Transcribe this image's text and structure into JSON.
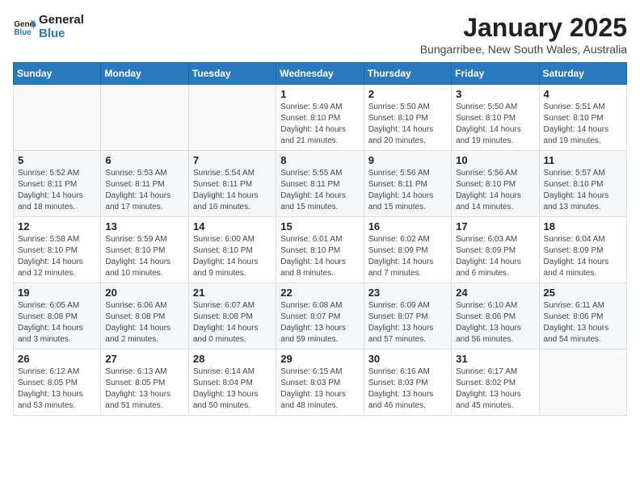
{
  "logo": {
    "text_general": "General",
    "text_blue": "Blue"
  },
  "header": {
    "title": "January 2025",
    "subtitle": "Bungarribee, New South Wales, Australia"
  },
  "weekdays": [
    "Sunday",
    "Monday",
    "Tuesday",
    "Wednesday",
    "Thursday",
    "Friday",
    "Saturday"
  ],
  "weeks": [
    [
      {
        "day": "",
        "info": ""
      },
      {
        "day": "",
        "info": ""
      },
      {
        "day": "",
        "info": ""
      },
      {
        "day": "1",
        "info": "Sunrise: 5:49 AM\nSunset: 8:10 PM\nDaylight: 14 hours\nand 21 minutes."
      },
      {
        "day": "2",
        "info": "Sunrise: 5:50 AM\nSunset: 8:10 PM\nDaylight: 14 hours\nand 20 minutes."
      },
      {
        "day": "3",
        "info": "Sunrise: 5:50 AM\nSunset: 8:10 PM\nDaylight: 14 hours\nand 19 minutes."
      },
      {
        "day": "4",
        "info": "Sunrise: 5:51 AM\nSunset: 8:10 PM\nDaylight: 14 hours\nand 19 minutes."
      }
    ],
    [
      {
        "day": "5",
        "info": "Sunrise: 5:52 AM\nSunset: 8:11 PM\nDaylight: 14 hours\nand 18 minutes."
      },
      {
        "day": "6",
        "info": "Sunrise: 5:53 AM\nSunset: 8:11 PM\nDaylight: 14 hours\nand 17 minutes."
      },
      {
        "day": "7",
        "info": "Sunrise: 5:54 AM\nSunset: 8:11 PM\nDaylight: 14 hours\nand 16 minutes."
      },
      {
        "day": "8",
        "info": "Sunrise: 5:55 AM\nSunset: 8:11 PM\nDaylight: 14 hours\nand 15 minutes."
      },
      {
        "day": "9",
        "info": "Sunrise: 5:56 AM\nSunset: 8:11 PM\nDaylight: 14 hours\nand 15 minutes."
      },
      {
        "day": "10",
        "info": "Sunrise: 5:56 AM\nSunset: 8:10 PM\nDaylight: 14 hours\nand 14 minutes."
      },
      {
        "day": "11",
        "info": "Sunrise: 5:57 AM\nSunset: 8:10 PM\nDaylight: 14 hours\nand 13 minutes."
      }
    ],
    [
      {
        "day": "12",
        "info": "Sunrise: 5:58 AM\nSunset: 8:10 PM\nDaylight: 14 hours\nand 12 minutes."
      },
      {
        "day": "13",
        "info": "Sunrise: 5:59 AM\nSunset: 8:10 PM\nDaylight: 14 hours\nand 10 minutes."
      },
      {
        "day": "14",
        "info": "Sunrise: 6:00 AM\nSunset: 8:10 PM\nDaylight: 14 hours\nand 9 minutes."
      },
      {
        "day": "15",
        "info": "Sunrise: 6:01 AM\nSunset: 8:10 PM\nDaylight: 14 hours\nand 8 minutes."
      },
      {
        "day": "16",
        "info": "Sunrise: 6:02 AM\nSunset: 8:09 PM\nDaylight: 14 hours\nand 7 minutes."
      },
      {
        "day": "17",
        "info": "Sunrise: 6:03 AM\nSunset: 8:09 PM\nDaylight: 14 hours\nand 6 minutes."
      },
      {
        "day": "18",
        "info": "Sunrise: 6:04 AM\nSunset: 8:09 PM\nDaylight: 14 hours\nand 4 minutes."
      }
    ],
    [
      {
        "day": "19",
        "info": "Sunrise: 6:05 AM\nSunset: 8:08 PM\nDaylight: 14 hours\nand 3 minutes."
      },
      {
        "day": "20",
        "info": "Sunrise: 6:06 AM\nSunset: 8:08 PM\nDaylight: 14 hours\nand 2 minutes."
      },
      {
        "day": "21",
        "info": "Sunrise: 6:07 AM\nSunset: 8:08 PM\nDaylight: 14 hours\nand 0 minutes."
      },
      {
        "day": "22",
        "info": "Sunrise: 6:08 AM\nSunset: 8:07 PM\nDaylight: 13 hours\nand 59 minutes."
      },
      {
        "day": "23",
        "info": "Sunrise: 6:09 AM\nSunset: 8:07 PM\nDaylight: 13 hours\nand 57 minutes."
      },
      {
        "day": "24",
        "info": "Sunrise: 6:10 AM\nSunset: 8:06 PM\nDaylight: 13 hours\nand 56 minutes."
      },
      {
        "day": "25",
        "info": "Sunrise: 6:11 AM\nSunset: 8:06 PM\nDaylight: 13 hours\nand 54 minutes."
      }
    ],
    [
      {
        "day": "26",
        "info": "Sunrise: 6:12 AM\nSunset: 8:05 PM\nDaylight: 13 hours\nand 53 minutes."
      },
      {
        "day": "27",
        "info": "Sunrise: 6:13 AM\nSunset: 8:05 PM\nDaylight: 13 hours\nand 51 minutes."
      },
      {
        "day": "28",
        "info": "Sunrise: 6:14 AM\nSunset: 8:04 PM\nDaylight: 13 hours\nand 50 minutes."
      },
      {
        "day": "29",
        "info": "Sunrise: 6:15 AM\nSunset: 8:03 PM\nDaylight: 13 hours\nand 48 minutes."
      },
      {
        "day": "30",
        "info": "Sunrise: 6:16 AM\nSunset: 8:03 PM\nDaylight: 13 hours\nand 46 minutes."
      },
      {
        "day": "31",
        "info": "Sunrise: 6:17 AM\nSunset: 8:02 PM\nDaylight: 13 hours\nand 45 minutes."
      },
      {
        "day": "",
        "info": ""
      }
    ]
  ]
}
